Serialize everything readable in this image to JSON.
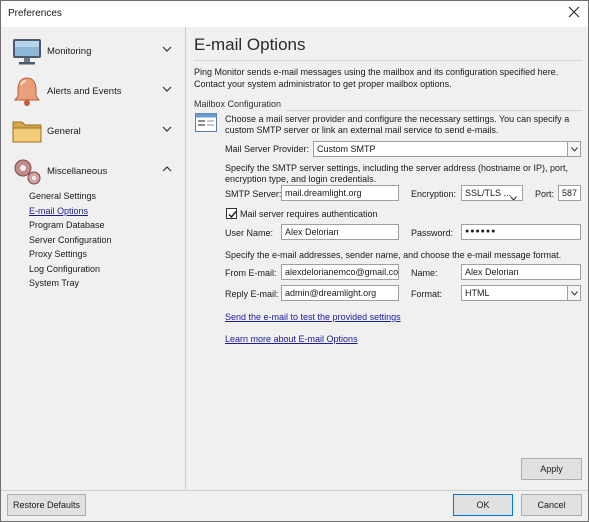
{
  "window": {
    "title": "Preferences"
  },
  "sidebar": {
    "categories": [
      {
        "label": "Monitoring",
        "icon": "monitor-icon"
      },
      {
        "label": "Alerts and Events",
        "icon": "bell-icon"
      },
      {
        "label": "General",
        "icon": "folder-icon"
      },
      {
        "label": "Miscellaneous",
        "icon": "gears-icon"
      }
    ],
    "sub_items": [
      {
        "label": "General Settings"
      },
      {
        "label": "E-mail Options",
        "selected": true
      },
      {
        "label": "Program Database"
      },
      {
        "label": "Server Configuration"
      },
      {
        "label": "Proxy Settings"
      },
      {
        "label": "Log Configuration"
      },
      {
        "label": "System Tray"
      }
    ]
  },
  "main": {
    "title": "E-mail Options",
    "intro": "Ping Monitor sends e-mail messages using the mailbox and its configuration specified here. Contact your system administrator to get proper mailbox options.",
    "section_label": "Mailbox Configuration",
    "provider_desc": "Choose a mail server provider and configure the necessary settings. You can specify a custom SMTP server or link an external mail service to send e-mails.",
    "provider_label": "Mail Server Provider:",
    "provider_value": "Custom SMTP",
    "smtp_desc": "Specify the SMTP server settings, including the server address (hostname or IP), port, encryption type, and login credentials.",
    "smtp_server_label": "SMTP Server:",
    "smtp_server_value": "mail.dreamlight.org",
    "encryption_label": "Encryption:",
    "encryption_value": "SSL/TLS ...",
    "port_label": "Port:",
    "port_value": "587",
    "auth_label": "Mail server requires authentication",
    "auth_checked": true,
    "username_label": "User Name:",
    "username_value": "Alex Delorian",
    "password_label": "Password:",
    "password_value": "●●●●●●",
    "addr_desc": "Specify the e-mail addresses, sender name, and choose the e-mail message format.",
    "from_label": "From E-mail:",
    "from_value": "alexdelorianemco@gmail.co",
    "name_label": "Name:",
    "name_value": "Alex Delorian",
    "reply_label": "Reply E-mail:",
    "reply_value": "admin@dreamlight.org",
    "format_label": "Format:",
    "format_value": "HTML",
    "test_link": "Send the e-mail to test the provided settings",
    "learn_link": "Learn more about E-mail Options",
    "apply_label": "Apply"
  },
  "footer": {
    "restore_label": "Restore Defaults",
    "ok_label": "OK",
    "cancel_label": "Cancel"
  },
  "colors": {
    "link": "#1a1a9a",
    "accent": "#0078d7",
    "background": "#f0f0f0"
  }
}
